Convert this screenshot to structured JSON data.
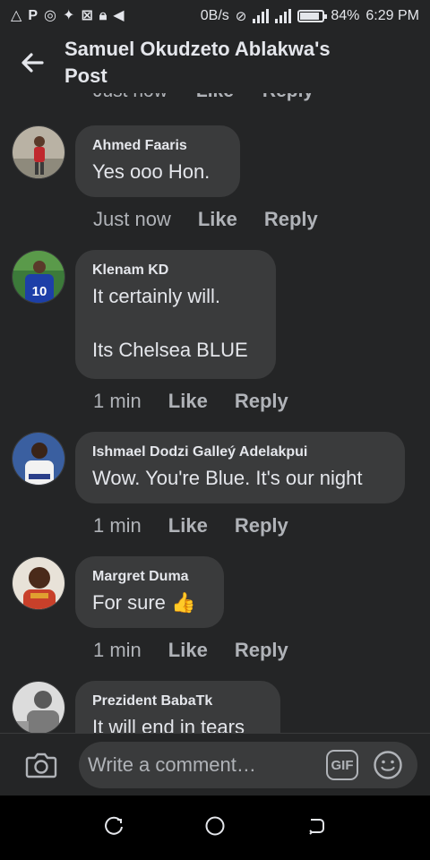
{
  "status_bar": {
    "left_icons": [
      "warning-icon",
      "parking-icon",
      "whatsapp-icon",
      "twitter-icon",
      "no-sim-icon",
      "lock-icon",
      "telegram-icon"
    ],
    "speed": "0B/s",
    "battery": "84%",
    "battery_level": 0.84,
    "time": "6:29 PM"
  },
  "header": {
    "title": "Samuel Okudzeto Ablakwa's Post"
  },
  "previous_comment_actions": {
    "time": "Just now",
    "like": "Like",
    "reply": "Reply"
  },
  "comments": [
    {
      "author": "Ahmed Faaris",
      "text": "Yes ooo Hon.",
      "time": "Just now",
      "like": "Like",
      "reply": "Reply"
    },
    {
      "author": "Klenam KD",
      "text": "It certainly will.\n\nIts Chelsea BLUE",
      "time": "1 min",
      "like": "Like",
      "reply": "Reply"
    },
    {
      "author": "Ishmael Dodzi Galleý Adelakpui",
      "text": "Wow. You're Blue. It's our night",
      "time": "1 min",
      "like": "Like",
      "reply": "Reply"
    },
    {
      "author": "Margret Duma",
      "text": "For sure 👍",
      "time": "1 min",
      "like": "Like",
      "reply": "Reply"
    },
    {
      "author": "Prezident BabaTk",
      "text": "It will end in tears"
    }
  ],
  "composer": {
    "placeholder": "Write a comment…",
    "gif_label": "GIF"
  },
  "colors": {
    "background": "#242526",
    "bubble": "#3a3b3c",
    "primary_text": "#e4e6eb",
    "secondary_text": "#b0b3b8"
  }
}
